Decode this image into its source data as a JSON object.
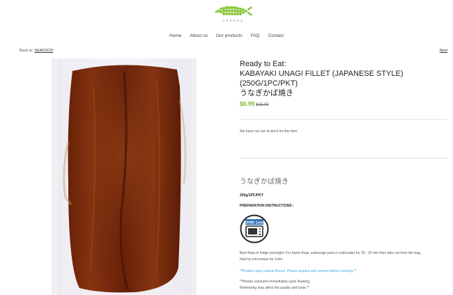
{
  "brand": {
    "name": "SAKANA"
  },
  "nav": {
    "items": [
      "Home",
      "About us",
      "Our products",
      "FAQ",
      "Contact"
    ]
  },
  "breadcrumb": {
    "prefix": "Back to:",
    "link": "SEAFOOD"
  },
  "pager": {
    "next": "Next"
  },
  "product": {
    "subtitle": "Ready to Eat:",
    "title_line1": "KABAYAKI UNAGI FILLET (JAPANESE STYLE)",
    "title_line2": "(250G/1PC/PKT)",
    "title_line3": "うなぎかば焼き",
    "price": "$6.99",
    "compare_price": "$15.00",
    "stock_message": "We have run out of stock for this item."
  },
  "description": {
    "title": "うなぎかば焼き",
    "pack": "250g/1PC/PKT",
    "prep_heading": "PREPARATION INSTRUCTIONS :",
    "microwave_label": "600W 1min",
    "instruction_line1": "Best thaw in fridge overnight. For faster thaw, submerge pack in cold water for 15 - 20  min then take out from the bag,",
    "instruction_line2": "heat by microwave for 1min.",
    "bones_note": "**Product may contain Bones. Please inspect and remove before cooking.**",
    "consume_line1": "**Please consume immediately upon thawing.",
    "consume_line2": "Refreezing may affect the quality and taste.**"
  },
  "colors": {
    "price": "#7ab52a",
    "note": "#3aa7e0",
    "logo": "#8cc63f"
  }
}
